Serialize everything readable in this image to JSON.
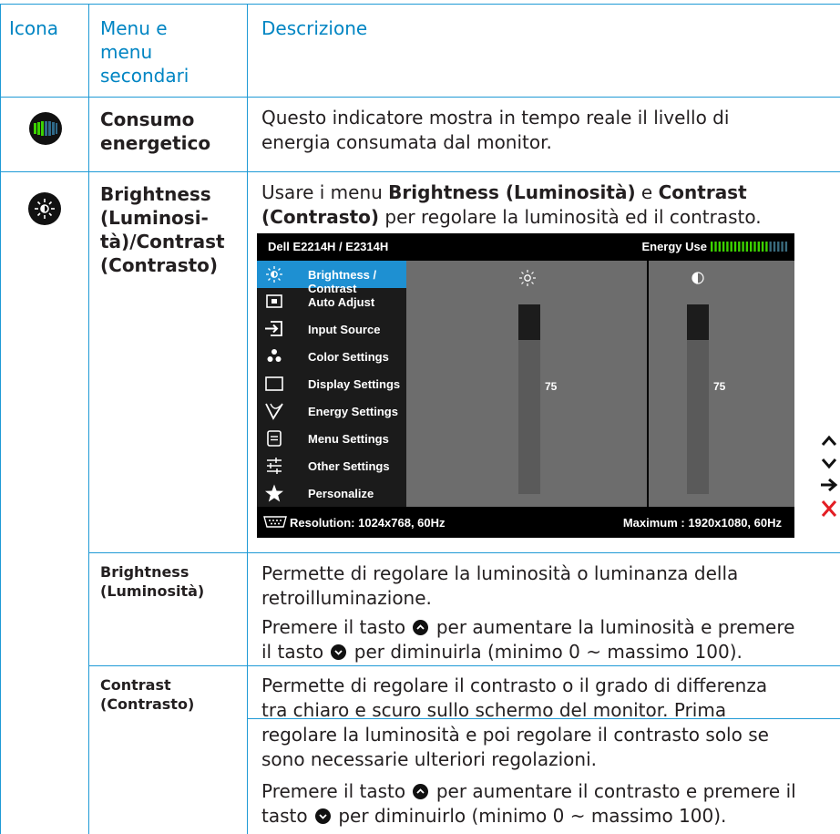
{
  "header": {
    "col1": "Icona",
    "col2_line1": "Menu e",
    "col2_line2": "menu",
    "col2_line3": "secondari",
    "col3": "Descrizione"
  },
  "row_energy": {
    "icon": "energy-meter-icon",
    "label_line1": "Consumo",
    "label_line2": "energetico",
    "desc_line1": "Questo indicatore mostra in tempo reale il livello di",
    "desc_line2": "energia consumata dal monitor."
  },
  "row_brightness": {
    "icon": "sun-icon",
    "label_line1": "Brightness",
    "label_line2": "(Luminosi-",
    "label_line3": "tà)/Contrast",
    "label_line4": "(Contrasto)",
    "desc_pre": "Usare i menu ",
    "desc_b1": "Brightness (Luminosità)",
    "desc_mid": " e ",
    "desc_b2": "Contrast",
    "desc_b3": "(Contrasto)",
    "desc_post": " per regolare la luminosità ed il contrasto."
  },
  "osd": {
    "title": "Dell E2214H / E2314H",
    "energy_label": "Energy Use",
    "menu": [
      {
        "label": "Brightness / Contrast",
        "icon": "sun-icon",
        "selected": true
      },
      {
        "label": "Auto Adjust",
        "icon": "auto-adjust-icon"
      },
      {
        "label": "Input Source",
        "icon": "input-source-icon"
      },
      {
        "label": "Color Settings",
        "icon": "color-dots-icon"
      },
      {
        "label": "Display Settings",
        "icon": "display-rect-icon"
      },
      {
        "label": "Energy Settings",
        "icon": "leaf-icon"
      },
      {
        "label": "Menu Settings",
        "icon": "menu-doc-icon"
      },
      {
        "label": "Other Settings",
        "icon": "sliders-icon"
      },
      {
        "label": "Personalize",
        "icon": "star-icon"
      }
    ],
    "brightness_value": "75",
    "contrast_value": "75",
    "brightness_level": 75,
    "contrast_level": 75,
    "resolution": "Resolution: 1024x768,  60Hz",
    "maximum": "Maximum : 1920x1080,  60Hz"
  },
  "nav_buttons": [
    "up-arrow-icon",
    "down-arrow-icon",
    "right-arrow-icon",
    "close-x-icon"
  ],
  "row_brightness_sub": {
    "label_line1": "Brightness",
    "label_line2": "(Luminosità)",
    "desc1_line1": "Permette di regolare la luminosità o luminanza della",
    "desc1_line2": "retroilluminazione.",
    "desc2_a": "Premere il tasto",
    "desc2_b": "per aumentare la luminosità e premere",
    "desc2_c": "il tasto",
    "desc2_d": "per diminuirla (minimo 0 ~ massimo 100)."
  },
  "row_contrast_sub": {
    "label_line1": "Contrast",
    "label_line2": "(Contrasto)",
    "desc1_line1": "Permette di regolare il contrasto o il grado di differenza",
    "desc1_line2": "tra chiaro e scuro sullo schermo del monitor. Prima",
    "desc1_line3": "regolare la luminosità e poi regolare il contrasto solo se",
    "desc1_line4": "sono necessarie ulteriori regolazioni.",
    "desc2_a": "Premere il tasto",
    "desc2_b": "per aumentare il contrasto e premere il",
    "desc2_c": "tasto",
    "desc2_d": "per diminuirlo (minimo 0 ~ massimo 100)."
  },
  "colors": {
    "accent": "#0085c3",
    "rule": "#1f9ad6",
    "osd_highlight": "#1e90d2",
    "energy_green": "#3cd200"
  }
}
